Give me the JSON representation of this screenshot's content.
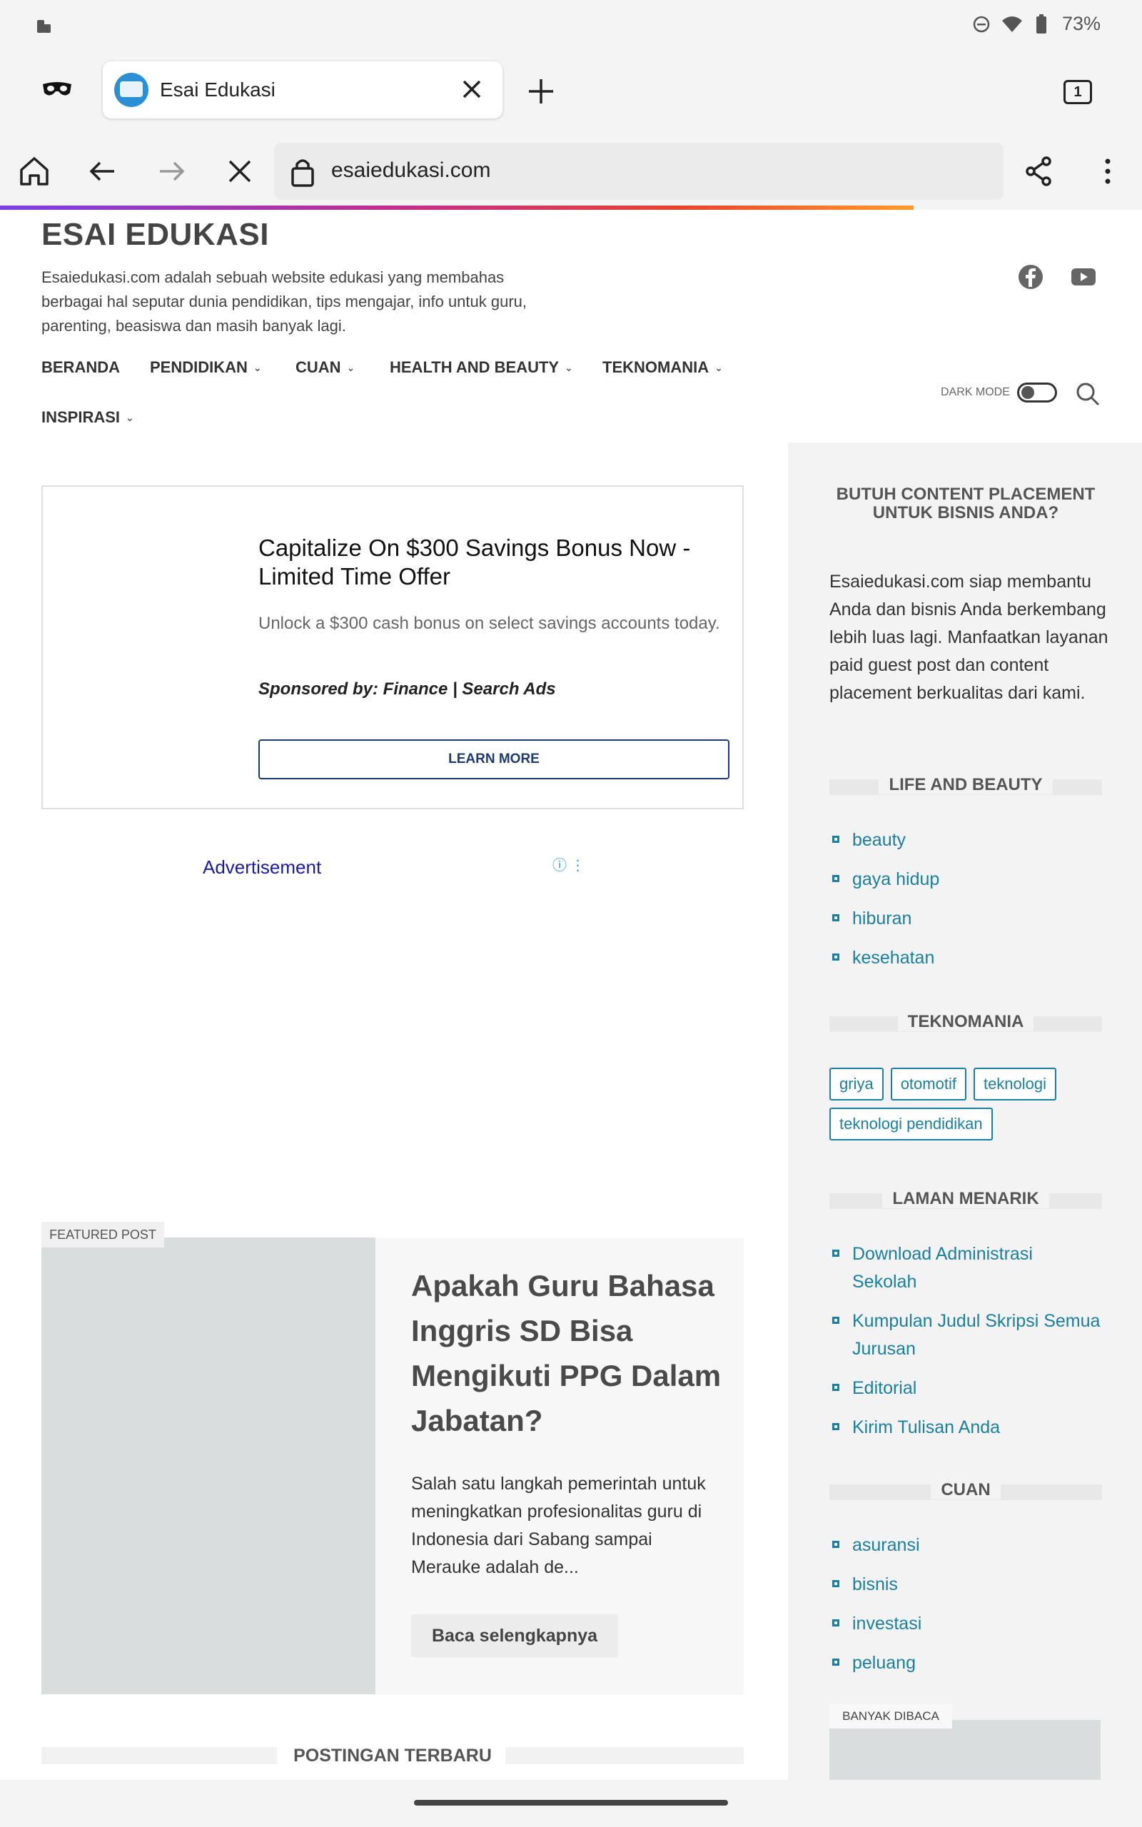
{
  "status": {
    "battery": "73%"
  },
  "tab": {
    "title": "Esai Edukasi",
    "count": "1"
  },
  "url": "esaiedukasi.com",
  "site": {
    "title": "ESAI EDUKASI",
    "description": "Esaiedukasi.com adalah sebuah website edukasi yang membahas berbagai hal seputar dunia pendidikan, tips mengajar, info untuk guru, parenting, beasiswa dan masih banyak lagi."
  },
  "nav": [
    "BERANDA",
    "PENDIDIKAN",
    "CUAN",
    "HEALTH AND BEAUTY",
    "TEKNOMANIA",
    "INSPIRASI"
  ],
  "dark_mode_label": "DARK MODE",
  "ad": {
    "headline": "Capitalize On $300 Savings Bonus Now - Limited Time Offer",
    "sub": "Unlock a $300 cash bonus on select savings accounts today.",
    "sponsor": "Sponsored by: Finance | Search Ads",
    "button": "LEARN MORE",
    "label": "Advertisement"
  },
  "featured": {
    "badge": "FEATURED POST",
    "title": "Apakah Guru Bahasa Inggris SD Bisa Mengikuti PPG Dalam Jabatan?",
    "excerpt": "Salah satu langkah pemerintah untuk meningkatkan profesionalitas guru di Indonesia dari Sabang sampai Merauke adalah de...",
    "button": "Baca selengkapnya"
  },
  "recent_heading": "POSTINGAN TERBARU",
  "sidebar": {
    "promo_heading": "BUTUH CONTENT PLACEMENT UNTUK BISNIS ANDA?",
    "promo_text": "Esaiedukasi.com siap membantu Anda dan bisnis Anda berkembang lebih luas lagi. Manfaatkan layanan paid guest post dan content placement berkualitas dari kami.",
    "life_heading": "LIFE AND BEAUTY",
    "life_items": [
      "beauty",
      "gaya hidup",
      "hiburan",
      "kesehatan"
    ],
    "tekno_heading": "TEKNOMANIA",
    "tekno_tags": [
      "griya",
      "otomotif",
      "teknologi",
      "teknologi pendidikan"
    ],
    "laman_heading": "LAMAN MENARIK",
    "laman_items": [
      "Download Administrasi Sekolah",
      "Kumpulan Judul Skripsi Semua Jurusan",
      "Editorial",
      "Kirim Tulisan Anda"
    ],
    "cuan_heading": "CUAN",
    "cuan_items": [
      "asuransi",
      "bisnis",
      "investasi",
      "peluang"
    ],
    "banyak_badge": "BANYAK DIBACA"
  }
}
